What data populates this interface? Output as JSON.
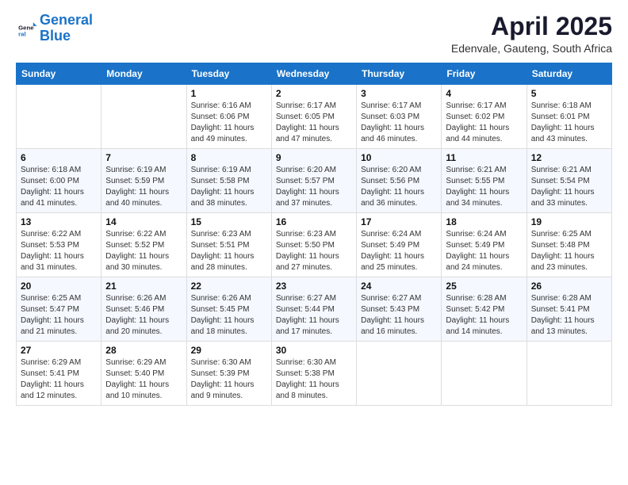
{
  "logo": {
    "line1": "General",
    "line2": "Blue"
  },
  "title": "April 2025",
  "location": "Edenvale, Gauteng, South Africa",
  "weekdays": [
    "Sunday",
    "Monday",
    "Tuesday",
    "Wednesday",
    "Thursday",
    "Friday",
    "Saturday"
  ],
  "weeks": [
    [
      {
        "day": "",
        "info": ""
      },
      {
        "day": "",
        "info": ""
      },
      {
        "day": "1",
        "info": "Sunrise: 6:16 AM\nSunset: 6:06 PM\nDaylight: 11 hours and 49 minutes."
      },
      {
        "day": "2",
        "info": "Sunrise: 6:17 AM\nSunset: 6:05 PM\nDaylight: 11 hours and 47 minutes."
      },
      {
        "day": "3",
        "info": "Sunrise: 6:17 AM\nSunset: 6:03 PM\nDaylight: 11 hours and 46 minutes."
      },
      {
        "day": "4",
        "info": "Sunrise: 6:17 AM\nSunset: 6:02 PM\nDaylight: 11 hours and 44 minutes."
      },
      {
        "day": "5",
        "info": "Sunrise: 6:18 AM\nSunset: 6:01 PM\nDaylight: 11 hours and 43 minutes."
      }
    ],
    [
      {
        "day": "6",
        "info": "Sunrise: 6:18 AM\nSunset: 6:00 PM\nDaylight: 11 hours and 41 minutes."
      },
      {
        "day": "7",
        "info": "Sunrise: 6:19 AM\nSunset: 5:59 PM\nDaylight: 11 hours and 40 minutes."
      },
      {
        "day": "8",
        "info": "Sunrise: 6:19 AM\nSunset: 5:58 PM\nDaylight: 11 hours and 38 minutes."
      },
      {
        "day": "9",
        "info": "Sunrise: 6:20 AM\nSunset: 5:57 PM\nDaylight: 11 hours and 37 minutes."
      },
      {
        "day": "10",
        "info": "Sunrise: 6:20 AM\nSunset: 5:56 PM\nDaylight: 11 hours and 36 minutes."
      },
      {
        "day": "11",
        "info": "Sunrise: 6:21 AM\nSunset: 5:55 PM\nDaylight: 11 hours and 34 minutes."
      },
      {
        "day": "12",
        "info": "Sunrise: 6:21 AM\nSunset: 5:54 PM\nDaylight: 11 hours and 33 minutes."
      }
    ],
    [
      {
        "day": "13",
        "info": "Sunrise: 6:22 AM\nSunset: 5:53 PM\nDaylight: 11 hours and 31 minutes."
      },
      {
        "day": "14",
        "info": "Sunrise: 6:22 AM\nSunset: 5:52 PM\nDaylight: 11 hours and 30 minutes."
      },
      {
        "day": "15",
        "info": "Sunrise: 6:23 AM\nSunset: 5:51 PM\nDaylight: 11 hours and 28 minutes."
      },
      {
        "day": "16",
        "info": "Sunrise: 6:23 AM\nSunset: 5:50 PM\nDaylight: 11 hours and 27 minutes."
      },
      {
        "day": "17",
        "info": "Sunrise: 6:24 AM\nSunset: 5:49 PM\nDaylight: 11 hours and 25 minutes."
      },
      {
        "day": "18",
        "info": "Sunrise: 6:24 AM\nSunset: 5:49 PM\nDaylight: 11 hours and 24 minutes."
      },
      {
        "day": "19",
        "info": "Sunrise: 6:25 AM\nSunset: 5:48 PM\nDaylight: 11 hours and 23 minutes."
      }
    ],
    [
      {
        "day": "20",
        "info": "Sunrise: 6:25 AM\nSunset: 5:47 PM\nDaylight: 11 hours and 21 minutes."
      },
      {
        "day": "21",
        "info": "Sunrise: 6:26 AM\nSunset: 5:46 PM\nDaylight: 11 hours and 20 minutes."
      },
      {
        "day": "22",
        "info": "Sunrise: 6:26 AM\nSunset: 5:45 PM\nDaylight: 11 hours and 18 minutes."
      },
      {
        "day": "23",
        "info": "Sunrise: 6:27 AM\nSunset: 5:44 PM\nDaylight: 11 hours and 17 minutes."
      },
      {
        "day": "24",
        "info": "Sunrise: 6:27 AM\nSunset: 5:43 PM\nDaylight: 11 hours and 16 minutes."
      },
      {
        "day": "25",
        "info": "Sunrise: 6:28 AM\nSunset: 5:42 PM\nDaylight: 11 hours and 14 minutes."
      },
      {
        "day": "26",
        "info": "Sunrise: 6:28 AM\nSunset: 5:41 PM\nDaylight: 11 hours and 13 minutes."
      }
    ],
    [
      {
        "day": "27",
        "info": "Sunrise: 6:29 AM\nSunset: 5:41 PM\nDaylight: 11 hours and 12 minutes."
      },
      {
        "day": "28",
        "info": "Sunrise: 6:29 AM\nSunset: 5:40 PM\nDaylight: 11 hours and 10 minutes."
      },
      {
        "day": "29",
        "info": "Sunrise: 6:30 AM\nSunset: 5:39 PM\nDaylight: 11 hours and 9 minutes."
      },
      {
        "day": "30",
        "info": "Sunrise: 6:30 AM\nSunset: 5:38 PM\nDaylight: 11 hours and 8 minutes."
      },
      {
        "day": "",
        "info": ""
      },
      {
        "day": "",
        "info": ""
      },
      {
        "day": "",
        "info": ""
      }
    ]
  ]
}
